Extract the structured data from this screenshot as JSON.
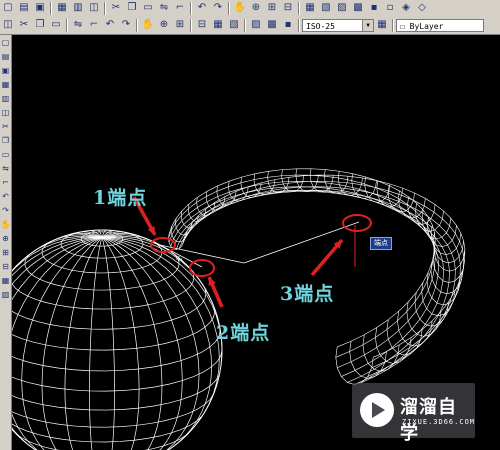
{
  "toolbar_top": {
    "icons": [
      "new-icon",
      "open-icon",
      "save-icon",
      "plot-icon",
      "preview-icon",
      "publish-icon",
      "cut-icon",
      "copy-icon",
      "paste-icon",
      "match-icon",
      "brush-icon",
      "undo-icon",
      "redo-icon",
      "pan-icon",
      "zoom-realtime-icon",
      "zoom-window-icon",
      "zoom-previous-icon",
      "properties-icon",
      "design-center-icon",
      "tool-palette-icon",
      "sheet-set-icon",
      "markup-icon",
      "calculator-icon",
      "layer-icon",
      "layer-state-icon"
    ]
  },
  "toolbar_dim": {
    "icons": [
      "linear-dim-icon",
      "aligned-dim-icon",
      "arc-length-icon",
      "ordinate-dim-icon",
      "radius-dim-icon",
      "jogged-dim-icon",
      "diameter-dim-icon",
      "angular-dim-icon",
      "quick-dim-icon",
      "baseline-dim-icon",
      "continue-dim-icon",
      "quick-leader-icon",
      "tolerance-icon",
      "center-mark-icon",
      "dim-edit-icon",
      "dim-text-edit-icon",
      "dim-update-icon"
    ],
    "dimstyle_value": "ISO-25",
    "layer_value": "ByLayer"
  },
  "left_toolbar": {
    "icons": [
      "line-icon",
      "construction-line-icon",
      "polyline-icon",
      "polygon-icon",
      "rectangle-icon",
      "arc-icon",
      "circle-icon",
      "revision-cloud-icon",
      "spline-icon",
      "ellipse-icon",
      "ellipse-arc-icon",
      "insert-block-icon",
      "make-block-icon",
      "point-icon",
      "hatch-icon",
      "gradient-icon",
      "region-icon",
      "table-icon",
      "mtext-icon"
    ]
  },
  "annotations": {
    "point1": "1端点",
    "point2": "2端点",
    "point3": "3端点",
    "snap_tooltip": "端点"
  },
  "watermark": {
    "brand": "溜溜自学",
    "url": "ZIXUE.3D66.COM"
  },
  "colors": {
    "wireframe": "#ffffff",
    "callout_text": "#6fd4dc",
    "marker": "#e02020",
    "toolbar_bg": "#d4d0c8"
  }
}
